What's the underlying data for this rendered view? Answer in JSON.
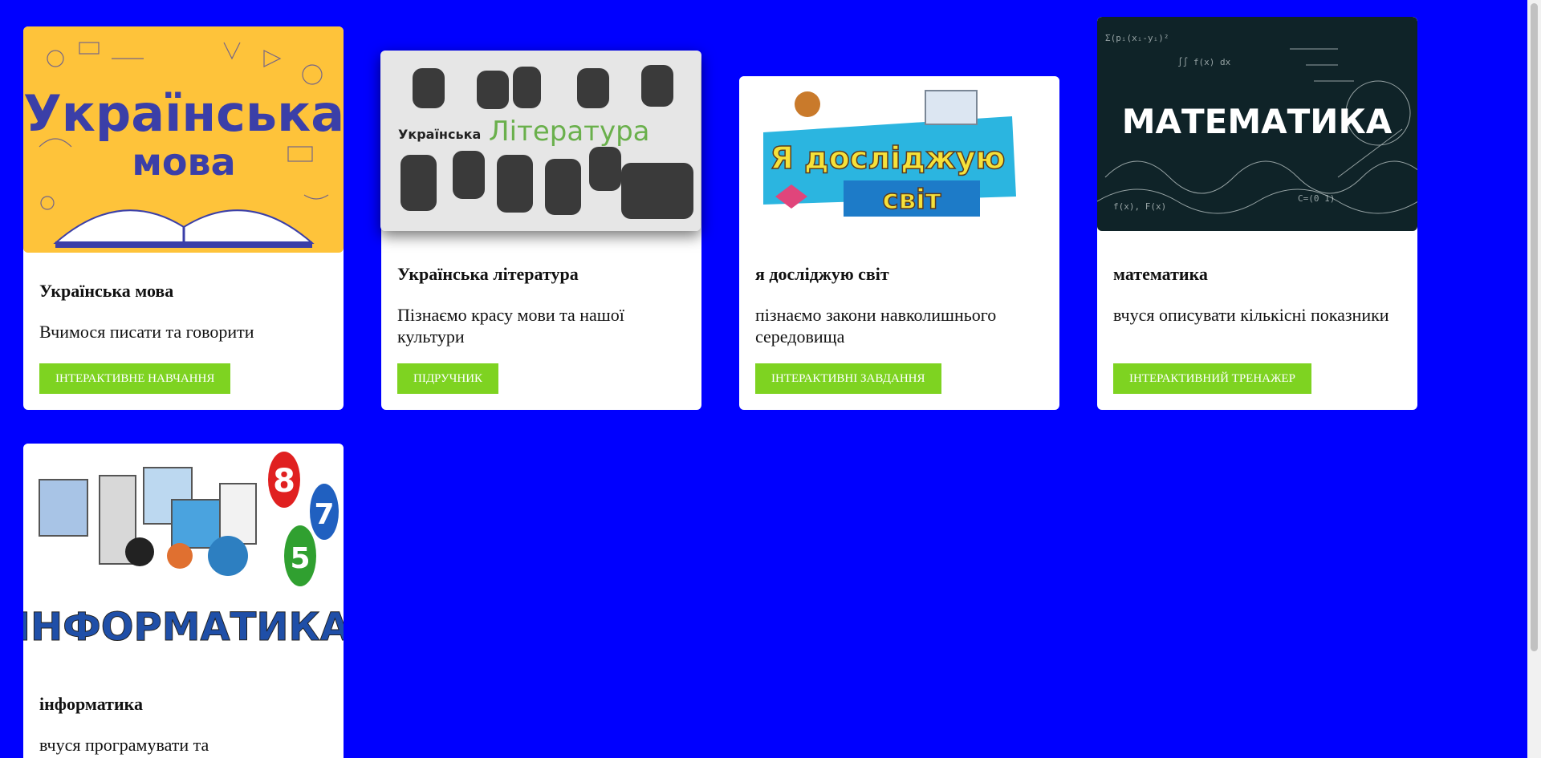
{
  "cards": [
    {
      "title": "Українська мова",
      "text": "Вчимося писати та говорити",
      "button": "Інтерактивне навчання",
      "image_text": [
        "Українська",
        "мова"
      ]
    },
    {
      "title": "Українська література",
      "text": "Пізнаємо красу мови та нашої культури",
      "button": "Підручник",
      "image_text": [
        "Українська",
        "Література"
      ]
    },
    {
      "title": "я досліджую світ",
      "text": "пізнаємо закони навколишнього середовища",
      "button": "Інтерактивні завдання",
      "image_text": [
        "Я досліджую",
        "світ"
      ]
    },
    {
      "title": "математика",
      "text": "вчуся описувати кількісні показники",
      "button": "Інтерактивний тренажер",
      "image_text": [
        "МАТЕМАТИКА"
      ]
    },
    {
      "title": "інформатика",
      "text": "вчуся програмувати та",
      "image_text": [
        "ІНФОРМАТИКА"
      ]
    }
  ],
  "colors": {
    "page_background": "#0000ff",
    "button": "#7ed321",
    "card": "#ffffff"
  }
}
